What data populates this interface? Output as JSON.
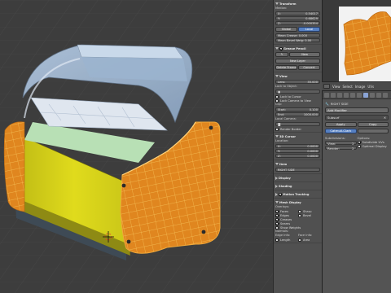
{
  "npanel": {
    "transform": {
      "title": "Transform",
      "median_label": "Median:",
      "x": {
        "label": "X:",
        "value": "0.54017"
      },
      "y": {
        "label": "Y:",
        "value": "0.68629"
      },
      "z": {
        "label": "Z:",
        "value": "-0.000354"
      },
      "global_btn": "Global",
      "local_btn": "Local",
      "mean_crease": "Mean Crease: 0.000",
      "mean_bevel": "Mean Bevel Weig: 0.00"
    },
    "grease_pencil": {
      "title": "Grease Pencil",
      "new_btn": "New",
      "new_layer_btn": "New Layer",
      "delete_frame": "Delete Frame",
      "convert": "Convert"
    },
    "view": {
      "title": "View",
      "lens": {
        "label": "Lens:",
        "value": "35.000"
      },
      "lock_to_object": "Lock to Object:",
      "lock_cursor": "Lock to Cursor",
      "lock_camera": "Lock Camera to View",
      "clip_label": "Clip:",
      "clip_start": {
        "label": "Start:",
        "value": "0.100"
      },
      "clip_end": {
        "label": "End:",
        "value": "1000.000"
      },
      "local_camera": "Local Camera:",
      "render_border": "Render Border"
    },
    "cursor": {
      "title": "3D Cursor",
      "location": "Location:",
      "x": {
        "label": "X:",
        "value": "0.0000"
      },
      "y": {
        "label": "Y:",
        "value": "0.0000"
      },
      "z": {
        "label": "Z:",
        "value": "0.0000"
      }
    },
    "item": {
      "title": "Item",
      "name": "RIGHT SIDE"
    },
    "display": {
      "title": "Display"
    },
    "shading": {
      "title": "Shading"
    },
    "motion_tracking": {
      "title": "Motion Tracking"
    },
    "mesh_display": {
      "title": "Mesh Display",
      "overlays": "Overlays:",
      "faces": "Faces",
      "sharp": "Sharp",
      "edges": "Edges",
      "bevel": "Bevel",
      "creases": "Creases",
      "seams": "Seams",
      "show_weights": "Show Weights",
      "normals": "Normals:",
      "edge_info": "Edge Info:",
      "face_info": "Face Info:",
      "length": "Length",
      "area": "Area"
    }
  },
  "uv_header": {
    "view": "View",
    "select": "Select",
    "image": "Image",
    "uvs": "UVs"
  },
  "properties": {
    "object_name": "RIGHT SIDE",
    "add_modifier": "Add Modifier",
    "modifier_name": "Subsurf",
    "apply_btn": "Apply",
    "copy_btn": "Copy",
    "mode_btn": "Catmull-Clark",
    "subdivisions_label": "Subdivisions:",
    "view_field": {
      "label": "View:",
      "value": "2"
    },
    "render_field": {
      "label": "Render:",
      "value": "2"
    },
    "options_label": "Options:",
    "subdivide_uvs": "Subdivide UVs",
    "optimal_display": "Optimal Display"
  },
  "colors": {
    "viewport_bg": "#3d3d3d",
    "mesh_orange": "#e08a20",
    "wire_yellow": "#f3b530",
    "body_yellow": "#d8d41a",
    "glass": "#a9c2df",
    "panel_gray": "#505050"
  }
}
